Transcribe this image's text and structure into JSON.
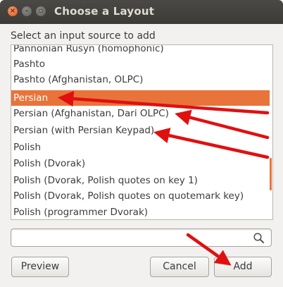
{
  "window": {
    "title": "Choose a Layout"
  },
  "instruction": "Select an input source to add",
  "list": {
    "items": [
      "Pannonian Rusyn (homophonic)",
      "Pashto",
      "Pashto (Afghanistan, OLPC)",
      "Persian",
      "Persian (Afghanistan, Dari OLPC)",
      "Persian (with Persian Keypad)",
      "Polish",
      "Polish (Dvorak)",
      "Polish (Dvorak, Polish quotes on key 1)",
      "Polish (Dvorak, Polish quotes on quotemark key)",
      "Polish (programmer Dvorak)"
    ],
    "selected_index": 3
  },
  "search": {
    "value": "",
    "icon": "search-icon"
  },
  "buttons": {
    "preview": "Preview",
    "cancel": "Cancel",
    "add": "Add"
  },
  "colors": {
    "accent": "#e8743b",
    "titlebar": "#3c3b37",
    "arrow": "#e01010"
  }
}
